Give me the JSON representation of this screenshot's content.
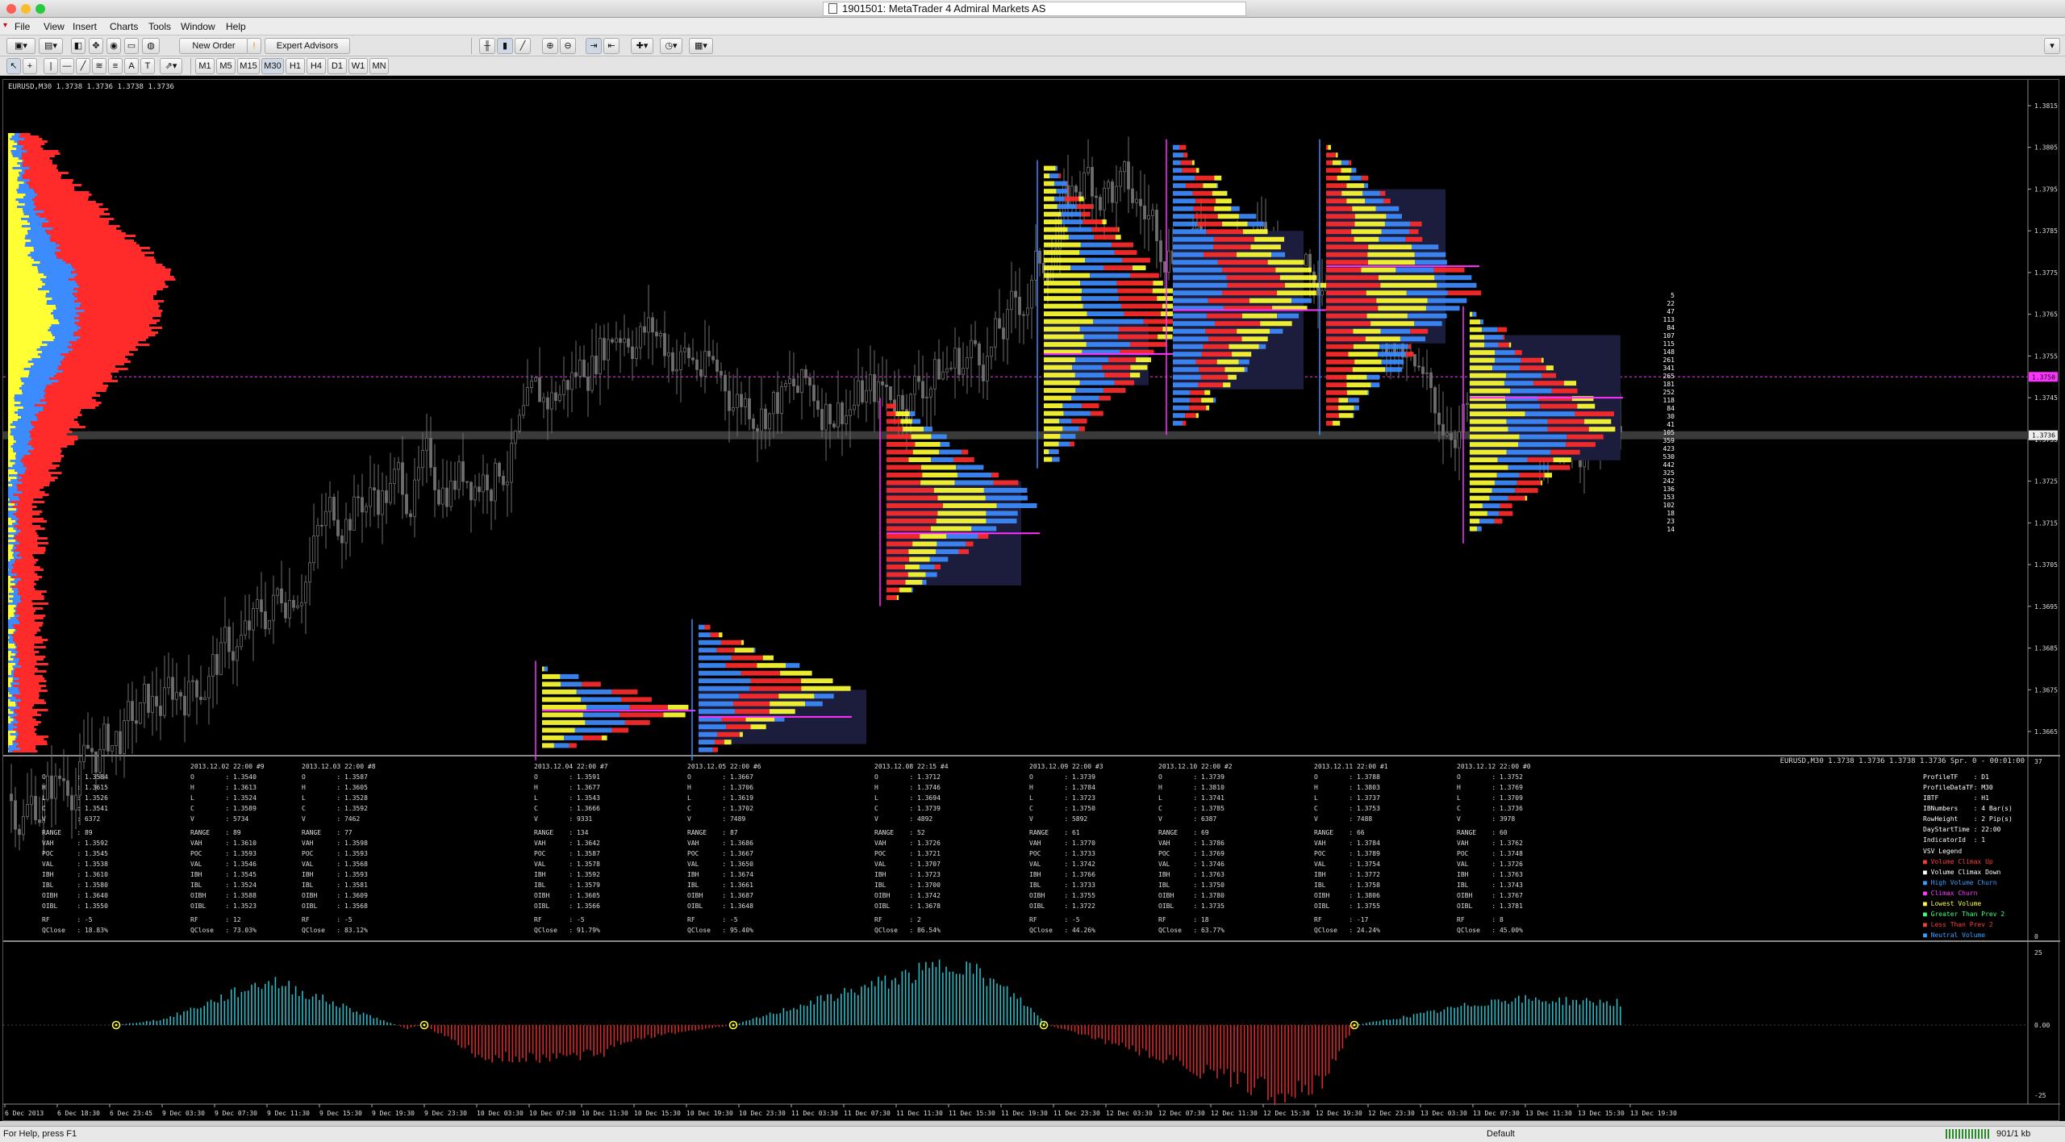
{
  "window": {
    "title": "1901501: MetaTrader 4 Admiral Markets AS"
  },
  "menu": [
    "File",
    "View",
    "Insert",
    "Charts",
    "Tools",
    "Window",
    "Help"
  ],
  "toolbar": {
    "new_order": "New Order",
    "expert_advisors": "Expert Advisors"
  },
  "timeframes": [
    "M1",
    "M5",
    "M15",
    "M30",
    "H1",
    "H4",
    "D1",
    "W1",
    "MN"
  ],
  "chart": {
    "symbol_label": "EURUSD,M30  1.3738 1.3736 1.3738 1.3736",
    "sub_label": "EURUSD,M30 1.3738 1.3736 1.3738 1.3736 Spr. 0 - 00:01:00",
    "price_ticks": [
      "1.3815",
      "1.3805",
      "1.3795",
      "1.3785",
      "1.3775",
      "1.3765",
      "1.3755",
      "1.3745",
      "1.3735",
      "1.3725",
      "1.3715",
      "1.3705",
      "1.3695",
      "1.3685",
      "1.3675",
      "1.3665"
    ],
    "current_price": "1.3736",
    "highlight_price": "1.3750",
    "osc_ticks": [
      "25",
      "0.00",
      "-25"
    ],
    "sub_axis": [
      "37",
      "0"
    ],
    "time_labels": [
      "6 Dec 2013",
      "6 Dec 18:30",
      "6 Dec 23:45",
      "9 Dec 03:30",
      "9 Dec 07:30",
      "9 Dec 11:30",
      "9 Dec 15:30",
      "9 Dec 19:30",
      "9 Dec 23:30",
      "10 Dec 03:30",
      "10 Dec 07:30",
      "10 Dec 11:30",
      "10 Dec 15:30",
      "10 Dec 19:30",
      "10 Dec 23:30",
      "11 Dec 03:30",
      "11 Dec 07:30",
      "11 Dec 11:30",
      "11 Dec 15:30",
      "11 Dec 19:30",
      "11 Dec 23:30",
      "12 Dec 03:30",
      "12 Dec 07:30",
      "12 Dec 11:30",
      "12 Dec 15:30",
      "12 Dec 19:30",
      "12 Dec 23:30",
      "13 Dec 03:30",
      "13 Dec 07:30",
      "13 Dec 11:30",
      "13 Dec 15:30",
      "13 Dec 19:30"
    ],
    "tpo_counts": [
      "5",
      "22",
      "47",
      "113",
      "84",
      "107",
      "115",
      "148",
      "261",
      "341",
      "265",
      "181",
      "252",
      "118",
      "84",
      "30",
      "41",
      "105",
      "359",
      "423",
      "530",
      "442",
      "325",
      "242",
      "136",
      "153",
      "102",
      "18",
      "23",
      "14"
    ]
  },
  "session_stats": [
    {
      "hdr": "",
      "rows": [
        [
          "O",
          "1.3584"
        ],
        [
          "H",
          "1.3615"
        ],
        [
          "L",
          "1.3526"
        ],
        [
          "C",
          "1.3541"
        ],
        [
          "V",
          "6372"
        ],
        [
          "RANGE",
          "89"
        ],
        [
          "VAH",
          "1.3592"
        ],
        [
          "POC",
          "1.3545"
        ],
        [
          "VAL",
          "1.3538"
        ],
        [
          "IBH",
          "1.3610"
        ],
        [
          "IBL",
          "1.3580"
        ],
        [
          "OIBH",
          "1.3640"
        ],
        [
          "OIBL",
          "1.3550"
        ],
        [
          "RF",
          "-5"
        ],
        [
          "QClose",
          "18.83%"
        ]
      ]
    },
    {
      "hdr": "2013.12.02 22:00 #9",
      "rows": [
        [
          "O",
          "1.3540"
        ],
        [
          "H",
          "1.3613"
        ],
        [
          "L",
          "1.3524"
        ],
        [
          "C",
          "1.3589"
        ],
        [
          "V",
          "5734"
        ],
        [
          "RANGE",
          "89"
        ],
        [
          "VAH",
          "1.3610"
        ],
        [
          "POC",
          "1.3593"
        ],
        [
          "VAL",
          "1.3546"
        ],
        [
          "IBH",
          "1.3545"
        ],
        [
          "IBL",
          "1.3524"
        ],
        [
          "OIBH",
          "1.3588"
        ],
        [
          "OIBL",
          "1.3523"
        ],
        [
          "RF",
          "12"
        ],
        [
          "QClose",
          "73.03%"
        ]
      ]
    },
    {
      "hdr": "2013.12.03 22:00 #8",
      "rows": [
        [
          "O",
          "1.3587"
        ],
        [
          "H",
          "1.3605"
        ],
        [
          "L",
          "1.3528"
        ],
        [
          "C",
          "1.3592"
        ],
        [
          "V",
          "7462"
        ],
        [
          "RANGE",
          "77"
        ],
        [
          "VAH",
          "1.3598"
        ],
        [
          "POC",
          "1.3593"
        ],
        [
          "VAL",
          "1.3568"
        ],
        [
          "IBH",
          "1.3593"
        ],
        [
          "IBL",
          "1.3581"
        ],
        [
          "OIBH",
          "1.3609"
        ],
        [
          "OIBL",
          "1.3568"
        ],
        [
          "RF",
          "-5"
        ],
        [
          "QClose",
          "83.12%"
        ]
      ]
    },
    {
      "hdr": "2013.12.04 22:00 #7",
      "rows": [
        [
          "O",
          "1.3591"
        ],
        [
          "H",
          "1.3677"
        ],
        [
          "L",
          "1.3543"
        ],
        [
          "C",
          "1.3666"
        ],
        [
          "V",
          "9331"
        ],
        [
          "RANGE",
          "134"
        ],
        [
          "VAH",
          "1.3642"
        ],
        [
          "POC",
          "1.3587"
        ],
        [
          "VAL",
          "1.3578"
        ],
        [
          "IBH",
          "1.3592"
        ],
        [
          "IBL",
          "1.3579"
        ],
        [
          "OIBH",
          "1.3605"
        ],
        [
          "OIBL",
          "1.3566"
        ],
        [
          "RF",
          "-5"
        ],
        [
          "QClose",
          "91.79%"
        ]
      ]
    },
    {
      "hdr": "2013.12.05 22:00 #6",
      "rows": [
        [
          "O",
          "1.3667"
        ],
        [
          "H",
          "1.3706"
        ],
        [
          "L",
          "1.3619"
        ],
        [
          "C",
          "1.3702"
        ],
        [
          "V",
          "7489"
        ],
        [
          "RANGE",
          "87"
        ],
        [
          "VAH",
          "1.3686"
        ],
        [
          "POC",
          "1.3667"
        ],
        [
          "VAL",
          "1.3650"
        ],
        [
          "IBH",
          "1.3674"
        ],
        [
          "IBL",
          "1.3661"
        ],
        [
          "OIBH",
          "1.3687"
        ],
        [
          "OIBL",
          "1.3648"
        ],
        [
          "RF",
          "-5"
        ],
        [
          "QClose",
          "95.40%"
        ]
      ]
    },
    {
      "hdr": "2013.12.08 22:15 #4",
      "rows": [
        [
          "O",
          "1.3712"
        ],
        [
          "H",
          "1.3746"
        ],
        [
          "L",
          "1.3694"
        ],
        [
          "C",
          "1.3739"
        ],
        [
          "V",
          "4892"
        ],
        [
          "RANGE",
          "52"
        ],
        [
          "VAH",
          "1.3726"
        ],
        [
          "POC",
          "1.3721"
        ],
        [
          "VAL",
          "1.3707"
        ],
        [
          "IBH",
          "1.3723"
        ],
        [
          "IBL",
          "1.3700"
        ],
        [
          "OIBH",
          "1.3742"
        ],
        [
          "OIBL",
          "1.3678"
        ],
        [
          "RF",
          "2"
        ],
        [
          "QClose",
          "86.54%"
        ]
      ]
    },
    {
      "hdr": "2013.12.09 22:00 #3",
      "rows": [
        [
          "O",
          "1.3739"
        ],
        [
          "H",
          "1.3784"
        ],
        [
          "L",
          "1.3723"
        ],
        [
          "C",
          "1.3750"
        ],
        [
          "V",
          "5892"
        ],
        [
          "RANGE",
          "61"
        ],
        [
          "VAH",
          "1.3770"
        ],
        [
          "POC",
          "1.3733"
        ],
        [
          "VAL",
          "1.3742"
        ],
        [
          "IBH",
          "1.3766"
        ],
        [
          "IBL",
          "1.3733"
        ],
        [
          "OIBH",
          "1.3755"
        ],
        [
          "OIBL",
          "1.3722"
        ],
        [
          "RF",
          "-5"
        ],
        [
          "QClose",
          "44.26%"
        ]
      ]
    },
    {
      "hdr": "2013.12.10 22:00 #2",
      "rows": [
        [
          "O",
          "1.3739"
        ],
        [
          "H",
          "1.3810"
        ],
        [
          "L",
          "1.3741"
        ],
        [
          "C",
          "1.3785"
        ],
        [
          "V",
          "6387"
        ],
        [
          "RANGE",
          "69"
        ],
        [
          "VAH",
          "1.3786"
        ],
        [
          "POC",
          "1.3769"
        ],
        [
          "VAL",
          "1.3746"
        ],
        [
          "IBH",
          "1.3763"
        ],
        [
          "IBL",
          "1.3750"
        ],
        [
          "OIBH",
          "1.3780"
        ],
        [
          "OIBL",
          "1.3735"
        ],
        [
          "RF",
          "18"
        ],
        [
          "QClose",
          "63.77%"
        ]
      ]
    },
    {
      "hdr": "2013.12.11 22:00 #1",
      "rows": [
        [
          "O",
          "1.3788"
        ],
        [
          "H",
          "1.3803"
        ],
        [
          "L",
          "1.3737"
        ],
        [
          "C",
          "1.3753"
        ],
        [
          "V",
          "7488"
        ],
        [
          "RANGE",
          "66"
        ],
        [
          "VAH",
          "1.3784"
        ],
        [
          "POC",
          "1.3789"
        ],
        [
          "VAL",
          "1.3754"
        ],
        [
          "IBH",
          "1.3772"
        ],
        [
          "IBL",
          "1.3758"
        ],
        [
          "OIBH",
          "1.3806"
        ],
        [
          "OIBL",
          "1.3755"
        ],
        [
          "RF",
          "-17"
        ],
        [
          "QClose",
          "24.24%"
        ]
      ]
    },
    {
      "hdr": "2013.12.12 22:00 #0",
      "rows": [
        [
          "O",
          "1.3752"
        ],
        [
          "H",
          "1.3769"
        ],
        [
          "L",
          "1.3709"
        ],
        [
          "C",
          "1.3736"
        ],
        [
          "V",
          "3978"
        ],
        [
          "RANGE",
          "60"
        ],
        [
          "VAH",
          "1.3762"
        ],
        [
          "POC",
          "1.3748"
        ],
        [
          "VAL",
          "1.3726"
        ],
        [
          "IBH",
          "1.3763"
        ],
        [
          "IBL",
          "1.3743"
        ],
        [
          "OIBH",
          "1.3767"
        ],
        [
          "OIBL",
          "1.3781"
        ],
        [
          "RF",
          "8"
        ],
        [
          "QClose",
          "45.00%"
        ]
      ]
    }
  ],
  "settings": [
    [
      "ProfileTF",
      ": D1"
    ],
    [
      "ProfileDataTF",
      ": M30"
    ],
    [
      "IBTF",
      ": H1"
    ],
    [
      "IBNumbers",
      ": 4 Bar(s)"
    ],
    [
      "RowHeight",
      ": 2 Pip(s)"
    ],
    [
      "DayStartTime",
      ": 22:00"
    ],
    [
      "IndicatorId",
      ": 1"
    ]
  ],
  "legend": {
    "title": "VSV Legend",
    "items": [
      {
        "text": "Volume Climax Up",
        "color": "#ff3b3b"
      },
      {
        "text": "Volume Climax Down",
        "color": "#ffffff"
      },
      {
        "text": "High Volume Churn",
        "color": "#3aa0ff"
      },
      {
        "text": "Climax Churn",
        "color": "#ff3bff"
      },
      {
        "text": "Lowest Volume",
        "color": "#ffff40"
      },
      {
        "text": "Greater Than Prev 2",
        "color": "#40ff80"
      },
      {
        "text": "Less Than Prev 2",
        "color": "#ff3b3b"
      },
      {
        "text": "Neutral Volume",
        "color": "#3aa0ff"
      }
    ]
  },
  "status": {
    "help": "For Help, press F1",
    "profile": "Default",
    "traffic": "901/1 kb"
  },
  "colors": {
    "bg": "#000000",
    "candle": "#6e6e6e",
    "tpo_yellow": "#ffff33",
    "tpo_red": "#ff2b2b",
    "tpo_blue": "#3d8cff",
    "va_box": "#1c1c3c",
    "poc": "#ff33ff",
    "osc_up": "#2fb8c4",
    "osc_down": "#d12a2a"
  }
}
